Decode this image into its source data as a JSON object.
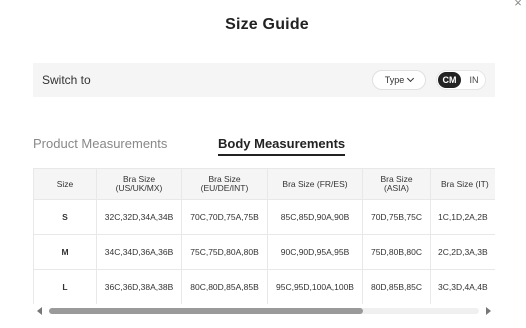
{
  "dialog": {
    "close_icon": "close-icon",
    "title": "Size Guide"
  },
  "switch": {
    "label": "Switch to",
    "type_label": "Type",
    "units": [
      "CM",
      "IN"
    ],
    "selected_unit": "CM"
  },
  "tabs": [
    {
      "label": "Product Measurements",
      "active": false
    },
    {
      "label": "Body Measurements",
      "active": true
    }
  ],
  "table": {
    "headers": [
      [
        "Size"
      ],
      [
        "Bra Size",
        "(US/UK/MX)"
      ],
      [
        "Bra Size",
        "(EU/DE/INT)"
      ],
      [
        "Bra Size (FR/ES)"
      ],
      [
        "Bra Size",
        "(ASIA)"
      ],
      [
        "Bra Size (IT)"
      ]
    ],
    "rows": [
      [
        "S",
        "32C,32D,34A,34B",
        "70C,70D,75A,75B",
        "85C,85D,90A,90B",
        "70D,75B,75C",
        "1C,1D,2A,2B"
      ],
      [
        "M",
        "34C,34D,36A,36B",
        "75C,75D,80A,80B",
        "90C,90D,95A,95B",
        "75D,80B,80C",
        "2C,2D,3A,3B"
      ],
      [
        "L",
        "36C,36D,38A,38B",
        "80C,80D,85A,85B",
        "95C,95D,100A,100B",
        "80D,85B,85C",
        "3C,3D,4A,4B"
      ]
    ]
  },
  "scrollbar": {
    "position_fraction": 0.0,
    "visible_fraction": 0.73
  }
}
